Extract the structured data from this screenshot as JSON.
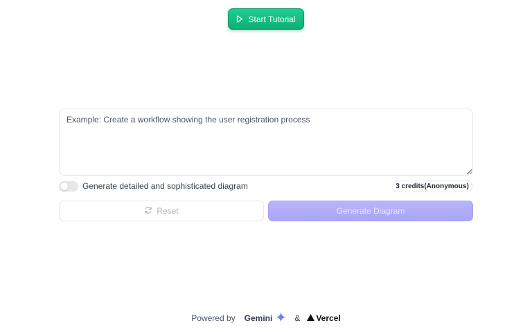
{
  "header": {
    "tutorial_label": "Start Tutorial",
    "tutorial_icon": "play-icon",
    "accent_color": "#10b981"
  },
  "prompt": {
    "placeholder": "Example: Create a workflow showing the user registration process",
    "value": ""
  },
  "options": {
    "detailed_label": "Generate detailed and sophisticated diagram",
    "detailed_enabled": false,
    "credits_label": "3 credits(Anonymous)"
  },
  "actions": {
    "reset_label": "Reset",
    "reset_icon": "refresh-icon",
    "generate_label": "Generate Diagram",
    "generate_color": "#a9a5f8"
  },
  "footer": {
    "powered_by": "Powered by",
    "gemini_label": "Gemini",
    "gemini_icon": "gemini-sparkle-icon",
    "ampersand": "&",
    "vercel_label": "Vercel",
    "vercel_icon": "vercel-triangle-icon"
  }
}
